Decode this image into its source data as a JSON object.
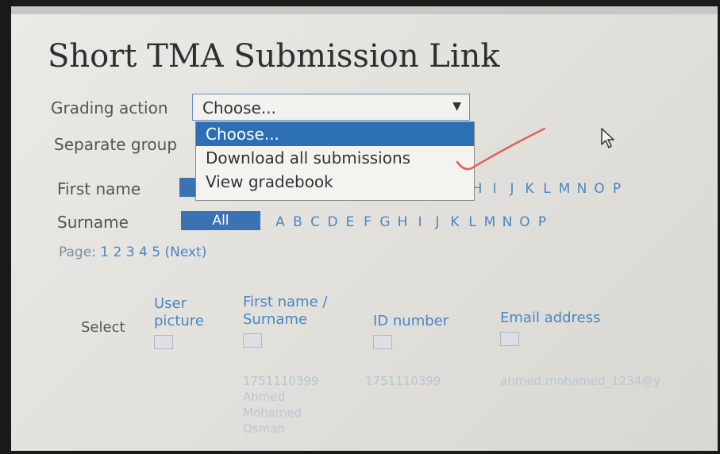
{
  "page": {
    "title": "Short TMA Submission Link"
  },
  "grading": {
    "label": "Grading action",
    "selected": "Choose...",
    "options": [
      "Choose...",
      "Download all submissions",
      "View gradebook"
    ]
  },
  "groups": {
    "label": "Separate group"
  },
  "first_name_filter": {
    "label": "First name",
    "letters": [
      "H",
      "I",
      "J",
      "K",
      "L",
      "M",
      "N",
      "O",
      "P"
    ]
  },
  "surname_filter": {
    "label": "Surname",
    "all_label": "All",
    "letters": [
      "A",
      "B",
      "C",
      "D",
      "E",
      "F",
      "G",
      "H",
      "I",
      "J",
      "K",
      "L",
      "M",
      "N",
      "O",
      "P"
    ]
  },
  "pagination": {
    "label": "Page:",
    "pages": [
      "1",
      "2",
      "3",
      "4",
      "5"
    ],
    "next": "(Next)"
  },
  "table": {
    "headers": {
      "select": "Select",
      "user_picture": "User picture",
      "name": "First name / Surname",
      "id_number": "ID number",
      "email": "Email address"
    },
    "rows": [
      {
        "name_line1": "1751110399",
        "name_line2": "Ahmed",
        "name_line3": "Mohamed",
        "name_line4": "Osman",
        "id_number": "1751110399",
        "email": "ahmed.mohamed_1234@y"
      }
    ]
  }
}
